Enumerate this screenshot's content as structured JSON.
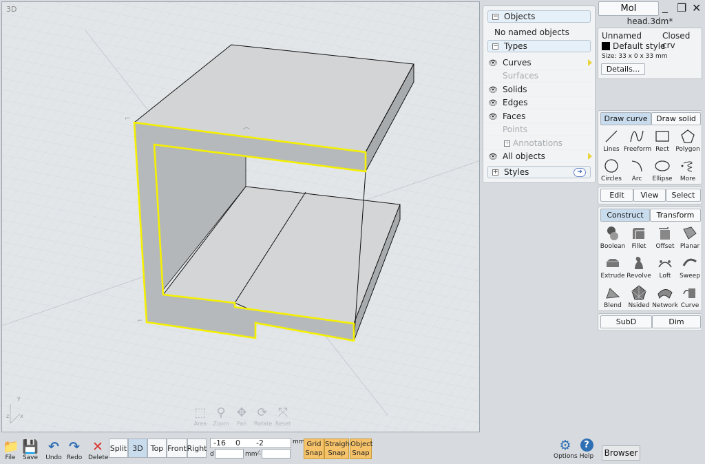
{
  "app": {
    "brand": "MoI",
    "filename": "head.3dm*"
  },
  "viewport": {
    "label": "3D",
    "nav_tools": [
      {
        "icon": "area-zoom-icon",
        "label": "Area"
      },
      {
        "icon": "zoom-icon",
        "label": "Zoom"
      },
      {
        "icon": "pan-icon",
        "label": "Pan"
      },
      {
        "icon": "rotate-icon",
        "label": "Rotate"
      },
      {
        "icon": "reset-icon",
        "label": "Reset"
      }
    ],
    "axes": {
      "y": "y",
      "x": "x",
      "z": "z"
    }
  },
  "scene_browser": {
    "objects_header": "Objects",
    "no_named": "No named objects",
    "types_header": "Types",
    "types": [
      {
        "label": "Curves",
        "visible": true,
        "enabled": true,
        "arrow": true
      },
      {
        "label": "Surfaces",
        "visible": false,
        "enabled": false,
        "arrow": false
      },
      {
        "label": "Solids",
        "visible": true,
        "enabled": true,
        "arrow": false
      },
      {
        "label": "Edges",
        "visible": true,
        "enabled": true,
        "arrow": false
      },
      {
        "label": "Faces",
        "visible": true,
        "enabled": true,
        "arrow": false
      },
      {
        "label": "Points",
        "visible": false,
        "enabled": false,
        "arrow": false
      },
      {
        "label": "Annotations",
        "visible": false,
        "enabled": false,
        "arrow": false
      },
      {
        "label": "All objects",
        "visible": true,
        "enabled": true,
        "arrow": true
      }
    ],
    "styles_header": "Styles"
  },
  "properties": {
    "name": "Unnamed",
    "kind": "Closed crv",
    "style": "Default style",
    "size": "Size: 33 x 0 x 33 mm",
    "details": "Details..."
  },
  "draw_tabs": {
    "curve": "Draw curve",
    "solid": "Draw solid"
  },
  "draw_tools": [
    "Lines",
    "Freeform",
    "Rect",
    "Polygon",
    "Circles",
    "Arc",
    "Ellipse",
    "More"
  ],
  "mode_tabs": {
    "edit": "Edit",
    "view": "View",
    "select": "Select"
  },
  "construct_tabs": {
    "construct": "Construct",
    "transform": "Transform"
  },
  "construct_tools": [
    "Boolean",
    "Fillet",
    "Offset",
    "Planar",
    "Extrude",
    "Revolve",
    "Loft",
    "Sweep",
    "Blend",
    "Nsided",
    "Network",
    "Curve"
  ],
  "extra_tabs": {
    "subd": "SubD",
    "dim": "Dim"
  },
  "bottom": {
    "file": "File",
    "save": "Save",
    "undo": "Undo",
    "redo": "Redo",
    "delete": "Delete",
    "views": [
      "Split",
      "3D",
      "Top",
      "Front",
      "Right"
    ],
    "coord_x": "-16",
    "coord_y": "0",
    "coord_z": "-2",
    "unit": "mm",
    "d_label": "d",
    "d_unit": "mm",
    "grid_snap": "Grid Snap",
    "straight_snap": "Straight Snap",
    "object_snap": "Object Snap",
    "options": "Options",
    "help": "Help",
    "browser": "Browser"
  },
  "colors": {
    "accent": "#c9dcee",
    "snap": "#f6c36a",
    "highlight": "#f4f000",
    "delete": "#d9302c",
    "blue_icon": "#2f6fb3"
  }
}
